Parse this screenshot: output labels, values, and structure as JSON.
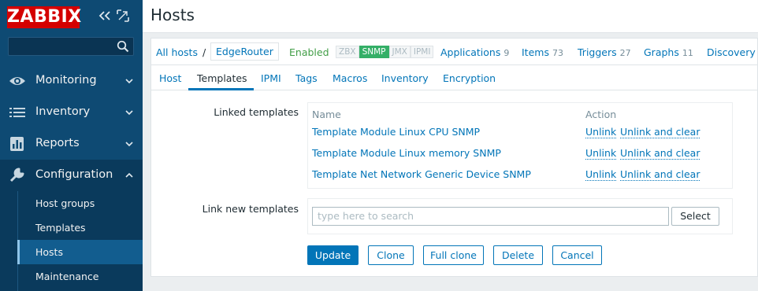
{
  "sidebar": {
    "logo": "ZABBIX",
    "search_placeholder": "",
    "items": [
      {
        "label": "Monitoring",
        "icon": "eye-icon"
      },
      {
        "label": "Inventory",
        "icon": "list-icon"
      },
      {
        "label": "Reports",
        "icon": "chart-icon"
      },
      {
        "label": "Configuration",
        "icon": "wrench-icon"
      }
    ],
    "submenu": [
      "Host groups",
      "Templates",
      "Hosts",
      "Maintenance"
    ]
  },
  "header": {
    "title": "Hosts"
  },
  "hostnav": {
    "all_hosts": "All hosts",
    "separator": "/",
    "current_host": "EdgeRouter",
    "status": "Enabled",
    "availability": [
      "ZBX",
      "SNMP",
      "JMX",
      "IPMI"
    ],
    "links": [
      {
        "label": "Applications",
        "count": "9"
      },
      {
        "label": "Items",
        "count": "73"
      },
      {
        "label": "Triggers",
        "count": "27"
      },
      {
        "label": "Graphs",
        "count": "11"
      },
      {
        "label": "Discovery",
        "count": ""
      }
    ]
  },
  "tabs": [
    "Host",
    "Templates",
    "IPMI",
    "Tags",
    "Macros",
    "Inventory",
    "Encryption"
  ],
  "linked": {
    "label": "Linked templates",
    "col_name": "Name",
    "col_action": "Action",
    "unlink": "Unlink",
    "unlink_clear": "Unlink and clear",
    "rows": [
      "Template Module Linux CPU SNMP",
      "Template Module Linux memory SNMP",
      "Template Net Network Generic Device SNMP"
    ]
  },
  "new_templates": {
    "label": "Link new templates",
    "placeholder": "type here to search",
    "select": "Select"
  },
  "buttons": {
    "update": "Update",
    "clone": "Clone",
    "full_clone": "Full clone",
    "delete": "Delete",
    "cancel": "Cancel"
  },
  "colors": {
    "sidebar": "#0e4a73",
    "accent": "#0275b8",
    "logo": "#d40000",
    "snmp": "#34af67"
  }
}
